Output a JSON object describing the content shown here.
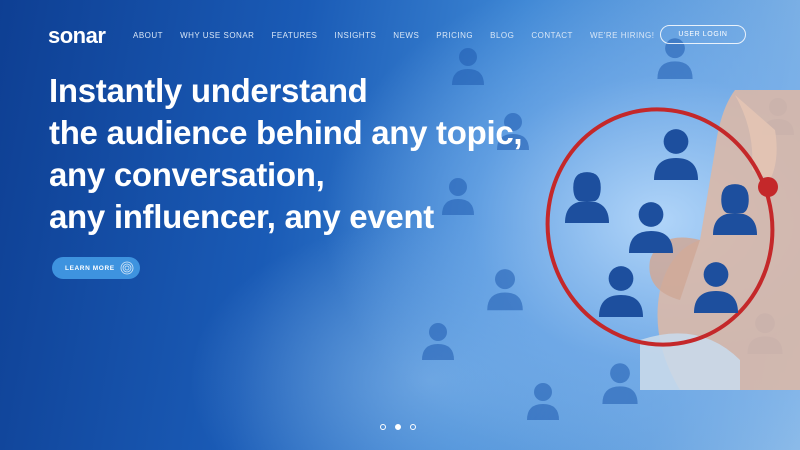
{
  "brand": {
    "name": "sonar"
  },
  "nav": {
    "items": [
      {
        "label": "ABOUT"
      },
      {
        "label": "WHY USE SONAR"
      },
      {
        "label": "FEATURES"
      },
      {
        "label": "INSIGHTS"
      },
      {
        "label": "NEWS"
      },
      {
        "label": "PRICING"
      },
      {
        "label": "BLOG"
      },
      {
        "label": "CONTACT"
      },
      {
        "label": "WE'RE HIRING!"
      }
    ],
    "login_label": "USER LOGIN"
  },
  "hero": {
    "headline_lines": [
      "Instantly understand",
      "the audience behind any topic,",
      "any conversation,",
      "any influencer, any event"
    ],
    "cta_label": "LEARN MORE"
  },
  "carousel": {
    "slide_count": 3,
    "active_index": 1
  },
  "colors": {
    "accent": "#3e93df",
    "marker_red": "#c4282a",
    "people_icon": "#1d4f9e"
  },
  "icons": [
    "sonar-logo-icon",
    "target-icon",
    "person-icon"
  ]
}
